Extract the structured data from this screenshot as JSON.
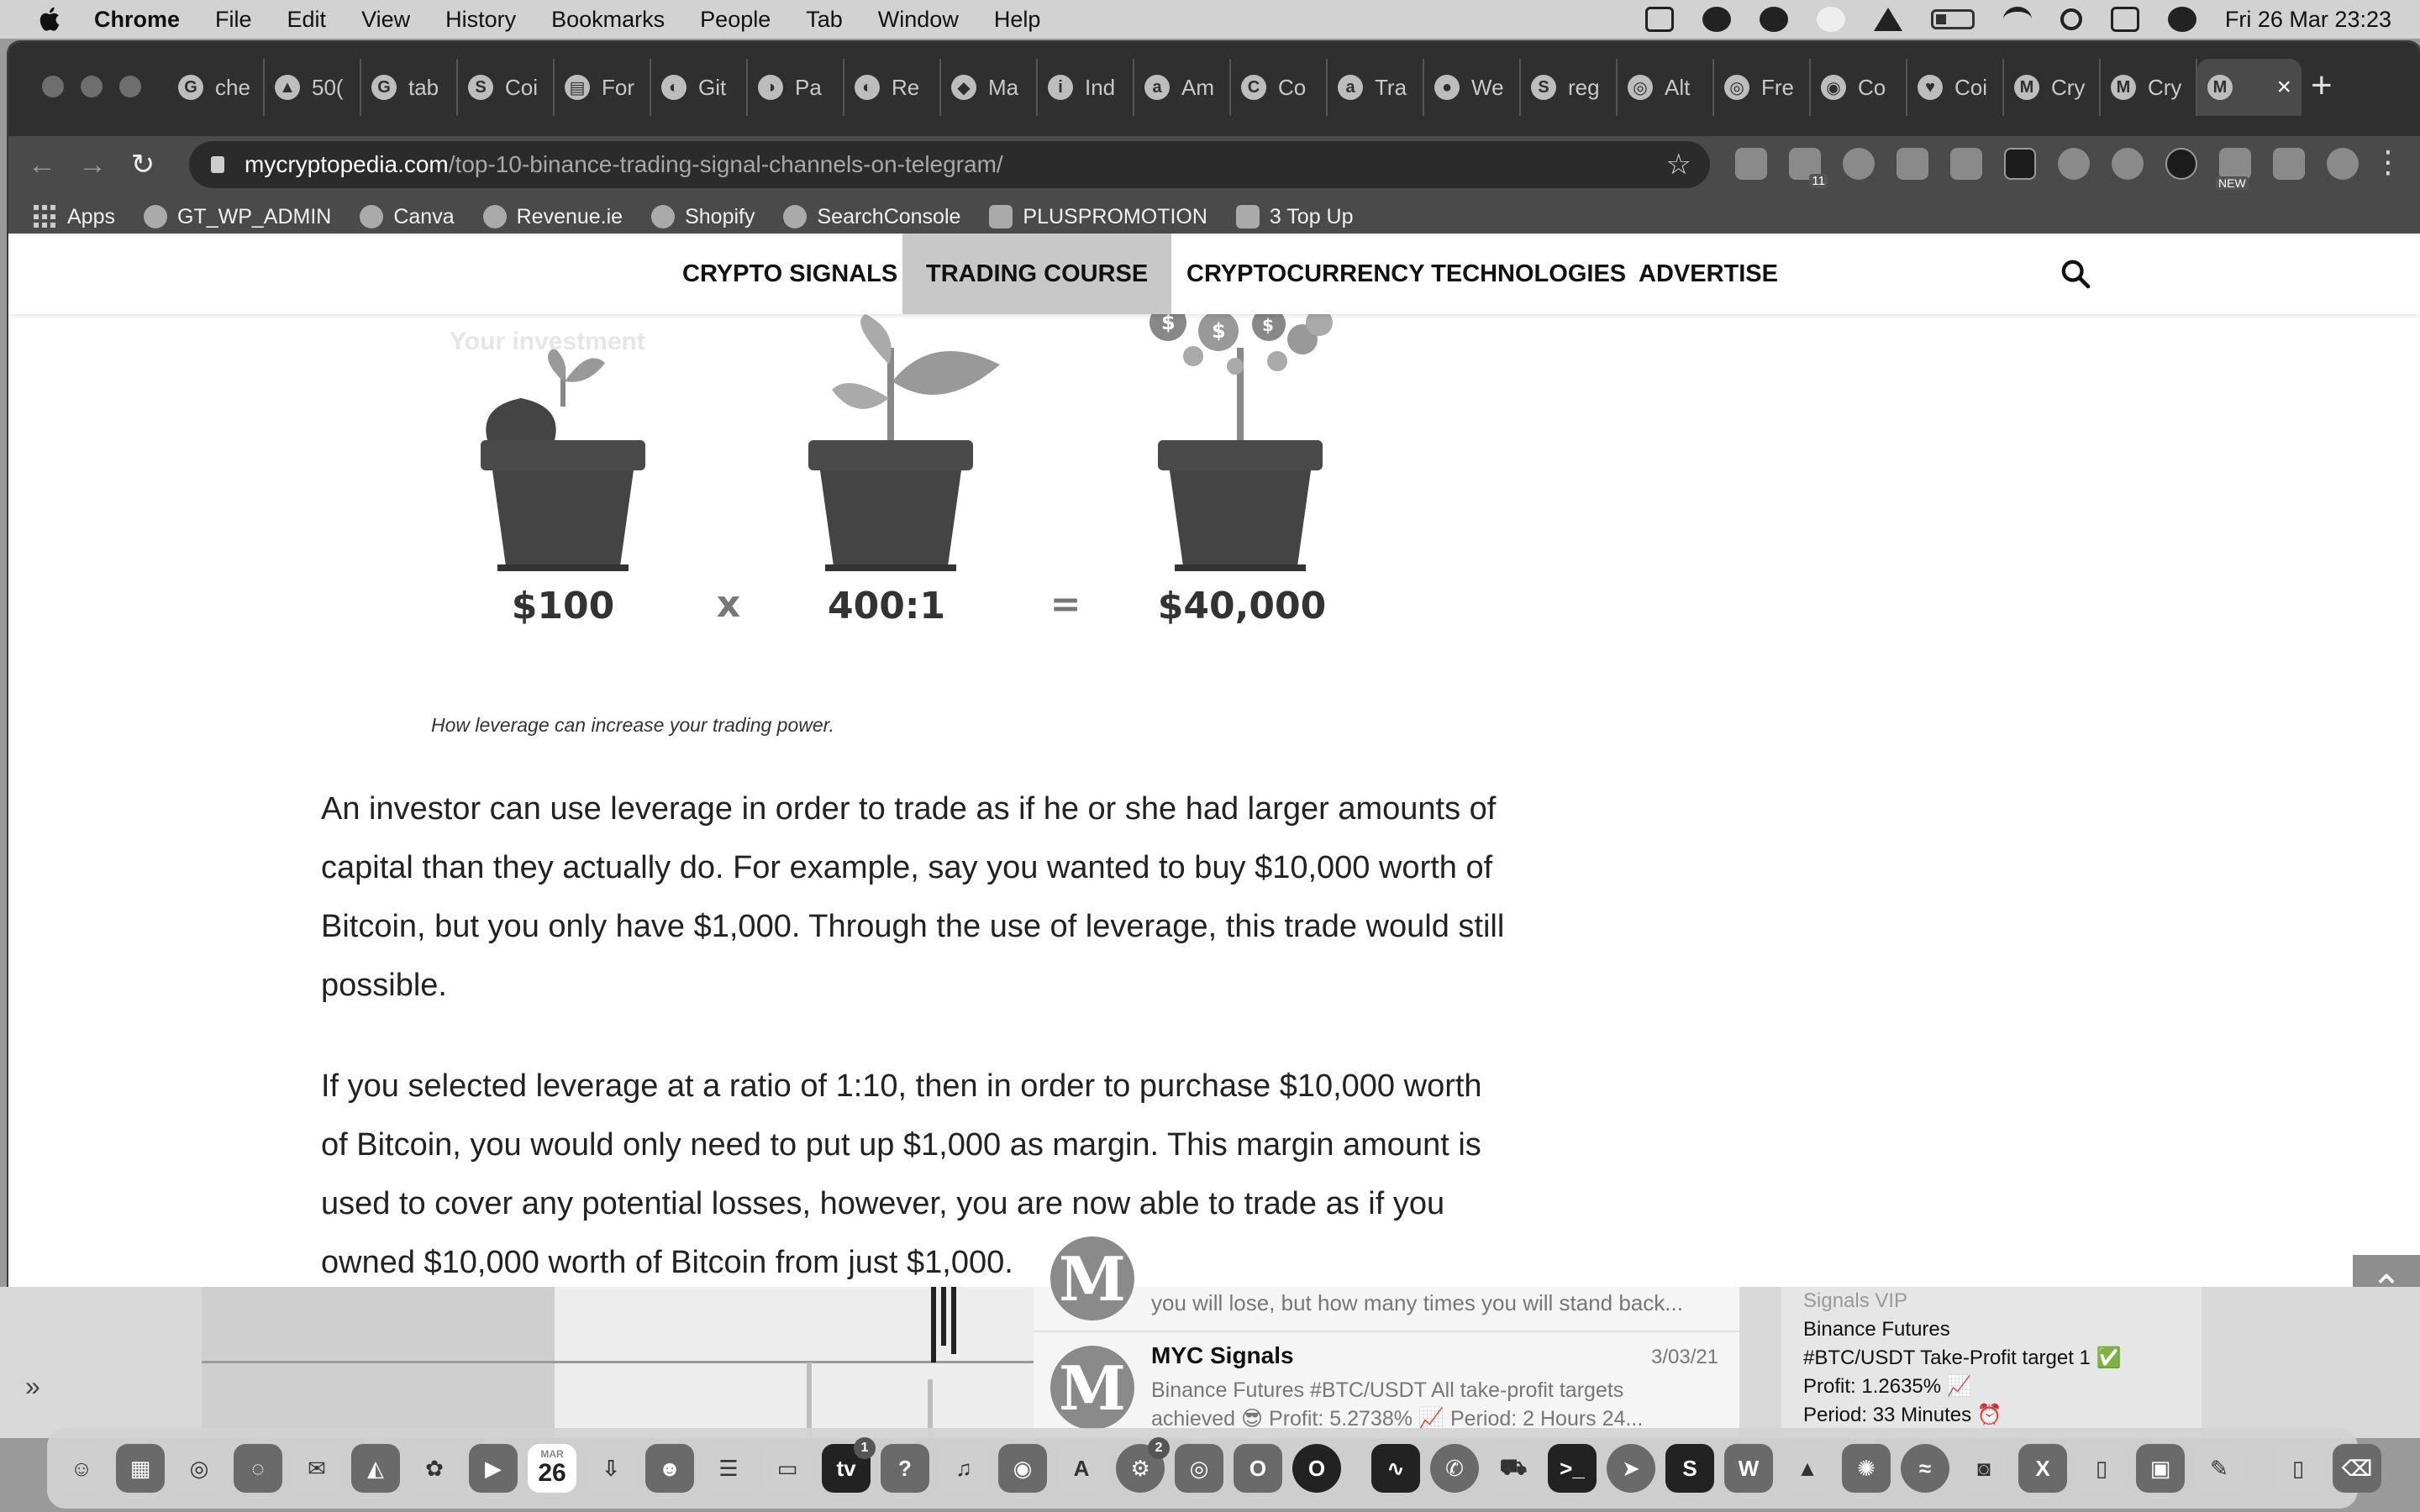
{
  "menubar": {
    "app": "Chrome",
    "items": [
      "File",
      "Edit",
      "View",
      "History",
      "Bookmarks",
      "People",
      "Tab",
      "Window",
      "Help"
    ],
    "clock": "Fri 26 Mar  23:23"
  },
  "tabs": [
    {
      "icon": "G",
      "label": "che"
    },
    {
      "icon": "▲",
      "label": "50("
    },
    {
      "icon": "G",
      "label": "tab"
    },
    {
      "icon": "S",
      "label": "Coi"
    },
    {
      "icon": "▤",
      "label": "For"
    },
    {
      "icon": "◐",
      "label": "Git"
    },
    {
      "icon": "◑",
      "label": "Pa"
    },
    {
      "icon": "◐",
      "label": "Re"
    },
    {
      "icon": "◆",
      "label": "Ma"
    },
    {
      "icon": "i",
      "label": "Ind"
    },
    {
      "icon": "a",
      "label": "Am"
    },
    {
      "icon": "C",
      "label": "Co"
    },
    {
      "icon": "a",
      "label": "Tra"
    },
    {
      "icon": "●",
      "label": "We"
    },
    {
      "icon": "S",
      "label": "reg"
    },
    {
      "icon": "◎",
      "label": "Alt"
    },
    {
      "icon": "◎",
      "label": "Fre"
    },
    {
      "icon": "◉",
      "label": "Co"
    },
    {
      "icon": "♥",
      "label": "Coi"
    },
    {
      "icon": "M",
      "label": "Cry"
    },
    {
      "icon": "M",
      "label": "Cry"
    },
    {
      "icon": "M",
      "label": ""
    }
  ],
  "address": {
    "domain": "mycryptopedia.com",
    "path": "/top-10-binance-trading-signal-channels-on-telegram/",
    "extension_badge": "11",
    "new_badge": "NEW"
  },
  "bookmarks": [
    "Apps",
    "GT_WP_ADMIN",
    "Canva",
    "Revenue.ie",
    "Shopify",
    "SearchConsole",
    "PLUSPROMOTION",
    "3 Top Up"
  ],
  "site_nav": [
    "CRYPTO SIGNALS",
    "TRADING COURSE",
    "CRYPTOCURRENCY TECHNOLOGIES",
    "ADVERTISE"
  ],
  "figure": {
    "faded_heading": "Your investment",
    "labels": [
      "$100",
      "x",
      "400:1",
      "=",
      "$40,000"
    ],
    "caption": "How leverage can increase your trading power."
  },
  "article": {
    "p1": "An investor can use leverage in order to trade as if he or she had larger amounts of capital than they actually do. For example, say you wanted to buy $10,000 worth of Bitcoin, but you only have $1,000. Through the use of leverage, this trade would still possible.",
    "p2": "If you selected leverage at a ratio of 1:10, then in order to purchase $10,000 worth of Bitcoin, you would only need to put up $1,000 as margin. This margin amount is used to cover any potential losses, however, you are now able to trade as if you owned $10,000 worth of Bitcoin from just $1,000."
  },
  "behind": {
    "prev_message": "you will lose, but how many times you will stand back...",
    "channel_name": "MYC Signals",
    "channel_date": "3/03/21",
    "channel_msg_1": "Binance Futures #BTC/USDT All take-profit targets",
    "channel_msg_2": "achieved 😎 Profit: 5.2738% 📈 Period: 2 Hours 24...",
    "signal_lines": [
      "Signals VIP",
      "Binance Futures",
      "#BTC/USDT Take-Profit target 1 ✅",
      "Profit: 1.2635% 📈",
      "Period: 33 Minutes ⏰"
    ]
  },
  "dock": {
    "calendar_month": "MAR",
    "calendar_day": "26",
    "appletv_badge": "1",
    "settings_badge": "2"
  }
}
